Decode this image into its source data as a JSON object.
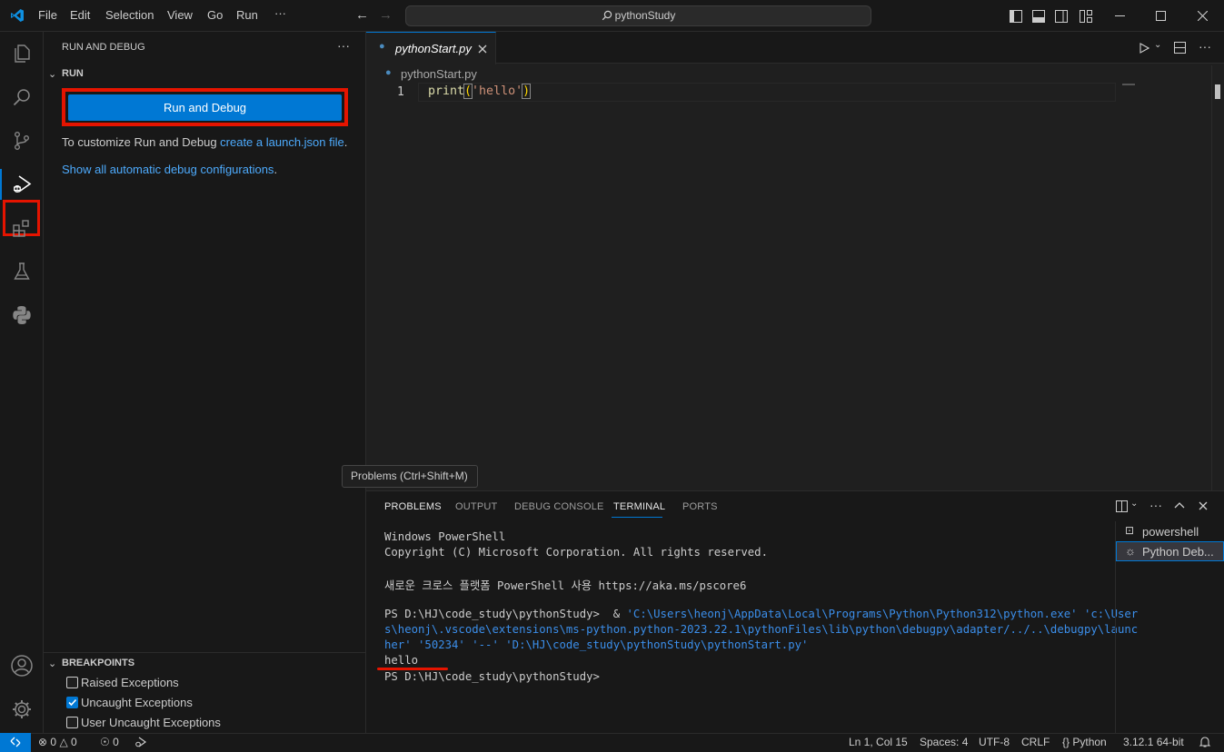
{
  "menu": {
    "file": "File",
    "edit": "Edit",
    "selection": "Selection",
    "view": "View",
    "go": "Go",
    "run": "Run",
    "more": "···"
  },
  "command_center": {
    "label": "pythonStudy"
  },
  "sidebar": {
    "title": "RUN AND DEBUG",
    "more": "···",
    "section": "RUN",
    "run_button": "Run and Debug",
    "customize_text": "To customize Run and Debug ",
    "customize_link": "create a launch.json file",
    "customize_end": ".",
    "show_link": "Show all automatic debug configurations",
    "show_end": ".",
    "breakpoints_title": "BREAKPOINTS",
    "breakpoints": [
      {
        "label": "Raised Exceptions",
        "checked": false
      },
      {
        "label": "Uncaught Exceptions",
        "checked": true
      },
      {
        "label": "User Uncaught Exceptions",
        "checked": false
      }
    ]
  },
  "editor": {
    "tab_label": "pythonStart.py",
    "breadcrumb": "pythonStart.py",
    "line_number": "1",
    "code_fn": "print",
    "code_open": "(",
    "code_str": "'hello'",
    "code_close": ")"
  },
  "tooltip": "Problems (Ctrl+Shift+M)",
  "panel": {
    "tabs": [
      "PROBLEMS",
      "OUTPUT",
      "DEBUG CONSOLE",
      "TERMINAL",
      "PORTS"
    ],
    "terminal_lines": [
      "Windows PowerShell",
      "Copyright (C) Microsoft Corporation. All rights reserved.",
      "새로운 크로스 플랫폼 PowerShell 사용 https://aka.ms/pscore6",
      "PS D:\\HJ\\code_study\\pythonStudy>  & ",
      "'C:\\Users\\heonj\\AppData\\Local\\Programs\\Python\\Python312\\python.exe' 'c:\\User",
      "s\\heonj\\.vscode\\extensions\\ms-python.python-2023.22.1\\pythonFiles\\lib\\python\\debugpy\\adapter/../..\\debugpy\\launc",
      "her' '50234' '--' 'D:\\HJ\\code_study\\pythonStudy\\pythonStart.py'",
      "hello",
      "PS D:\\HJ\\code_study\\pythonStudy>"
    ],
    "terminals": [
      "powershell",
      "Python Deb..."
    ]
  },
  "statusbar": {
    "errors": "0",
    "warnings": "0",
    "ports": "0",
    "position": "Ln 1, Col 15",
    "spaces": "Spaces: 4",
    "encoding": "UTF-8",
    "eol": "CRLF",
    "language": "Python",
    "interpreter": "3.12.1 64-bit"
  },
  "colors": {
    "accent": "#0078d4",
    "highlight_box": "#e51400",
    "link": "#4daafc",
    "string": "#ce9178",
    "function": "#dcdcaa",
    "terminal_blue": "#3b8eea"
  }
}
